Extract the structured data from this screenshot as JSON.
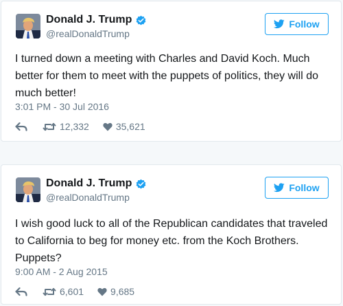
{
  "colors": {
    "accent": "#1da1f2",
    "text": "#14171a",
    "muted": "#657786",
    "border": "#e1e8ed"
  },
  "tweets": [
    {
      "name": "Donald J. Trump",
      "handle": "@realDonaldTrump",
      "follow_label": "Follow",
      "text": "I turned down a meeting with Charles and David Koch. Much better for them to meet with the puppets of politics, they will do much better!",
      "timestamp": "3:01 PM - 30 Jul 2016",
      "retweets": "12,332",
      "likes": "35,621",
      "icons": [
        "verified-badge-icon",
        "twitter-bird-icon",
        "reply-icon",
        "retweet-icon",
        "heart-icon"
      ]
    },
    {
      "name": "Donald J. Trump",
      "handle": "@realDonaldTrump",
      "follow_label": "Follow",
      "text": "I wish good luck to all of the Republican candidates that traveled to California to beg for money etc. from the Koch Brothers. Puppets?",
      "timestamp": "9:00 AM - 2 Aug 2015",
      "retweets": "6,601",
      "likes": "9,685",
      "icons": [
        "verified-badge-icon",
        "twitter-bird-icon",
        "reply-icon",
        "retweet-icon",
        "heart-icon"
      ]
    }
  ]
}
